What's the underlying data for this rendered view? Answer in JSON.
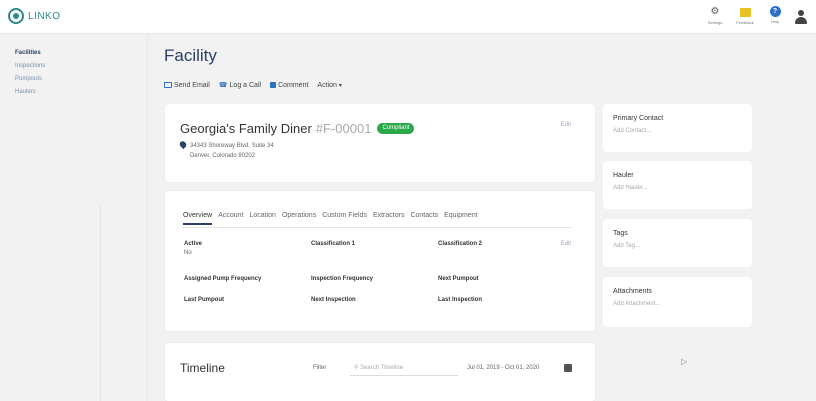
{
  "app": {
    "logo_text": "LINKO"
  },
  "top_icons": [
    {
      "label": "Settings",
      "icon": "gear-icon"
    },
    {
      "label": "Feedback",
      "icon": "feedback-icon"
    },
    {
      "label": "Help",
      "icon": "help-icon"
    }
  ],
  "sidebar": {
    "items": [
      {
        "label": "Facilities",
        "active": true
      },
      {
        "label": "Inspections"
      },
      {
        "label": "Pumpouts"
      },
      {
        "label": "Haulers"
      }
    ]
  },
  "header": {
    "title": "Facility",
    "actions": [
      "Send Email",
      "Log a Call",
      "Comment",
      "Action"
    ]
  },
  "facility": {
    "name": "Georgia's Family Diner",
    "id": "#F-00001",
    "status": "Compliant",
    "edit": "Edit",
    "address_line1": "34343 Shoreway Blvd, Suite 34",
    "address_line2": "Denver, Colorado 80202"
  },
  "details": {
    "tabs": [
      "Overview",
      "Account",
      "Location",
      "Operations",
      "Custom Fields",
      "Extractors",
      "Contacts",
      "Equipment"
    ],
    "edit": "Edit",
    "fields": [
      {
        "label": "Active",
        "value": "No"
      },
      {
        "label": "Classification 1",
        "value": ""
      },
      {
        "label": "Classification 2",
        "value": ""
      },
      {
        "label": "Assigned Pump Frequency",
        "value": ""
      },
      {
        "label": "Inspection Frequency",
        "value": ""
      },
      {
        "label": "Next Pumpout",
        "value": ""
      },
      {
        "label": "Last Pumpout",
        "value": ""
      },
      {
        "label": "Next Inspection",
        "value": ""
      },
      {
        "label": "Last Inspection",
        "value": ""
      }
    ]
  },
  "timeline": {
    "title": "Timeline",
    "filter_label": "Filter",
    "search_placeholder": "Search Timeline",
    "date_range": "Jul 01, 2019 - Oct 01, 2020"
  },
  "side_cards": [
    {
      "title": "Primary Contact",
      "add": "Add Contact..."
    },
    {
      "title": "Hauler",
      "add": "Add Hauler..."
    },
    {
      "title": "Tags",
      "add": "Add Tag..."
    },
    {
      "title": "Attachments",
      "add": "Add Attachment..."
    }
  ],
  "colors": {
    "brand": "#2b8a8a",
    "navy": "#2c3f66",
    "compliant": "#2aa84a",
    "link": "#2d6fc4"
  }
}
